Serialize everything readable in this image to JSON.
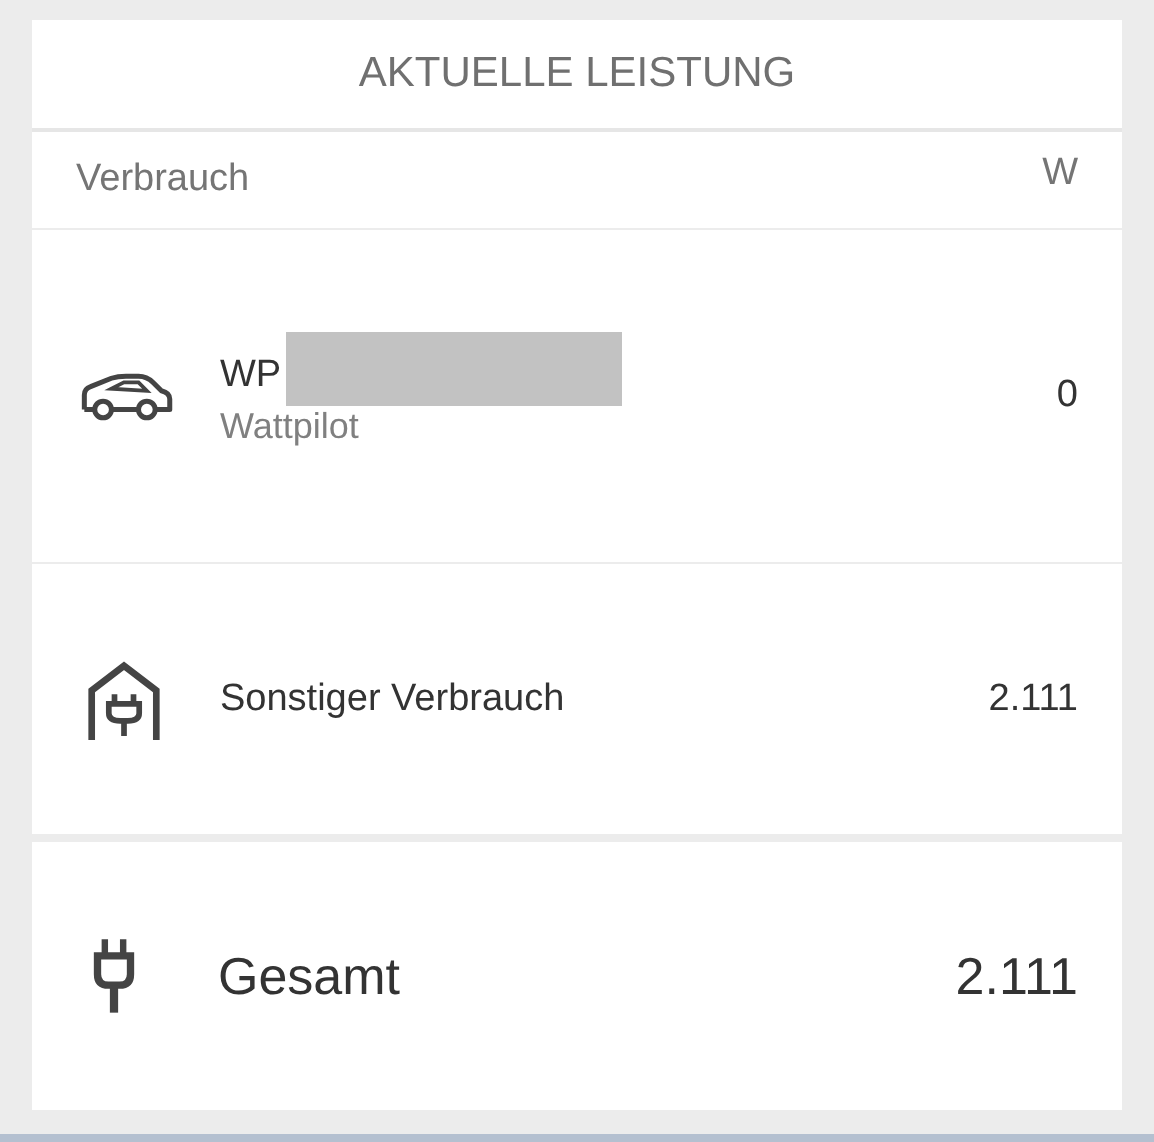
{
  "title": "AKTUELLE LEISTUNG",
  "header": {
    "label": "Verbrauch",
    "unit": "W"
  },
  "rows": [
    {
      "kind": "car",
      "name": "WP",
      "redacted": true,
      "subtitle": "Wattpilot",
      "value": "0"
    },
    {
      "kind": "house",
      "name": "Sonstiger Verbrauch",
      "value": "2.111"
    }
  ],
  "total": {
    "label": "Gesamt",
    "value": "2.111"
  }
}
